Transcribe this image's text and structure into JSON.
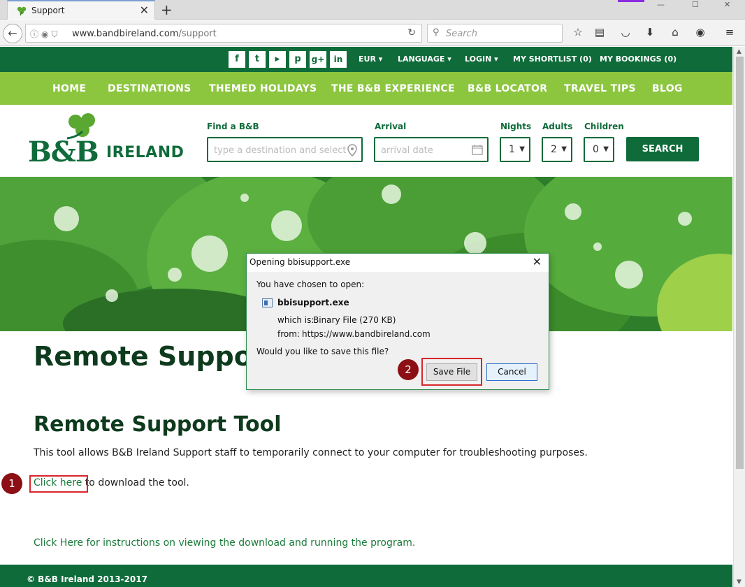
{
  "browser": {
    "tab_title": "Support",
    "url_host": "www.bandbireland.com",
    "url_path": "/support",
    "search_placeholder": "Search"
  },
  "site": {
    "top_nav": [
      "EUR ▾",
      "LANGUAGE ▾",
      "LOGIN ▾",
      "MY SHORTLIST (0)",
      "MY BOOKINGS (0)"
    ],
    "social": [
      "f",
      "t",
      "yt",
      "p",
      "g+",
      "in"
    ],
    "main_nav": [
      "HOME",
      "DESTINATIONS",
      "THEMED HOLIDAYS",
      "THE B&B EXPERIENCE",
      "B&B LOCATOR",
      "TRAVEL TIPS",
      "BLOG"
    ],
    "logo_bb": "B&B",
    "logo_ireland": "IRELAND",
    "search_form": {
      "find_label": "Find a B&B",
      "find_placeholder": "type a destination and select fr",
      "arrival_label": "Arrival",
      "arrival_placeholder": "arrival date",
      "nights_label": "Nights",
      "nights_value": "1",
      "adults_label": "Adults",
      "adults_value": "2",
      "children_label": "Children",
      "children_value": "0",
      "search_button": "SEARCH"
    }
  },
  "content": {
    "heading": "Remote Suppo",
    "subheading": "Remote Support Tool",
    "description": "This tool allows B&B Ireland Support staff to temporarily connect to your computer for troubleshooting purposes.",
    "download_link": "Click here",
    "download_rest": " to download the tool.",
    "instructions_link": "Click Here for instructions on viewing the download and running the program.",
    "footer": "© B&B Ireland 2013-2017"
  },
  "annotations": {
    "badge1": "1",
    "badge2": "2"
  },
  "dialog": {
    "title": "Opening bbisupport.exe",
    "chosen": "You have chosen to open:",
    "filename": "bbisupport.exe",
    "which_is_label": "which is:",
    "which_is_value": "Binary File (270 KB)",
    "from_label": "from:",
    "from_value": "https://www.bandbireland.com",
    "question": "Would you like to save this file?",
    "save_button": "Save File",
    "cancel_button": "Cancel"
  },
  "colors": {
    "dark_green": "#0f6b3a",
    "light_green": "#8cc63f",
    "annotation_red": "#d9262c",
    "badge_red": "#8b0f14"
  }
}
